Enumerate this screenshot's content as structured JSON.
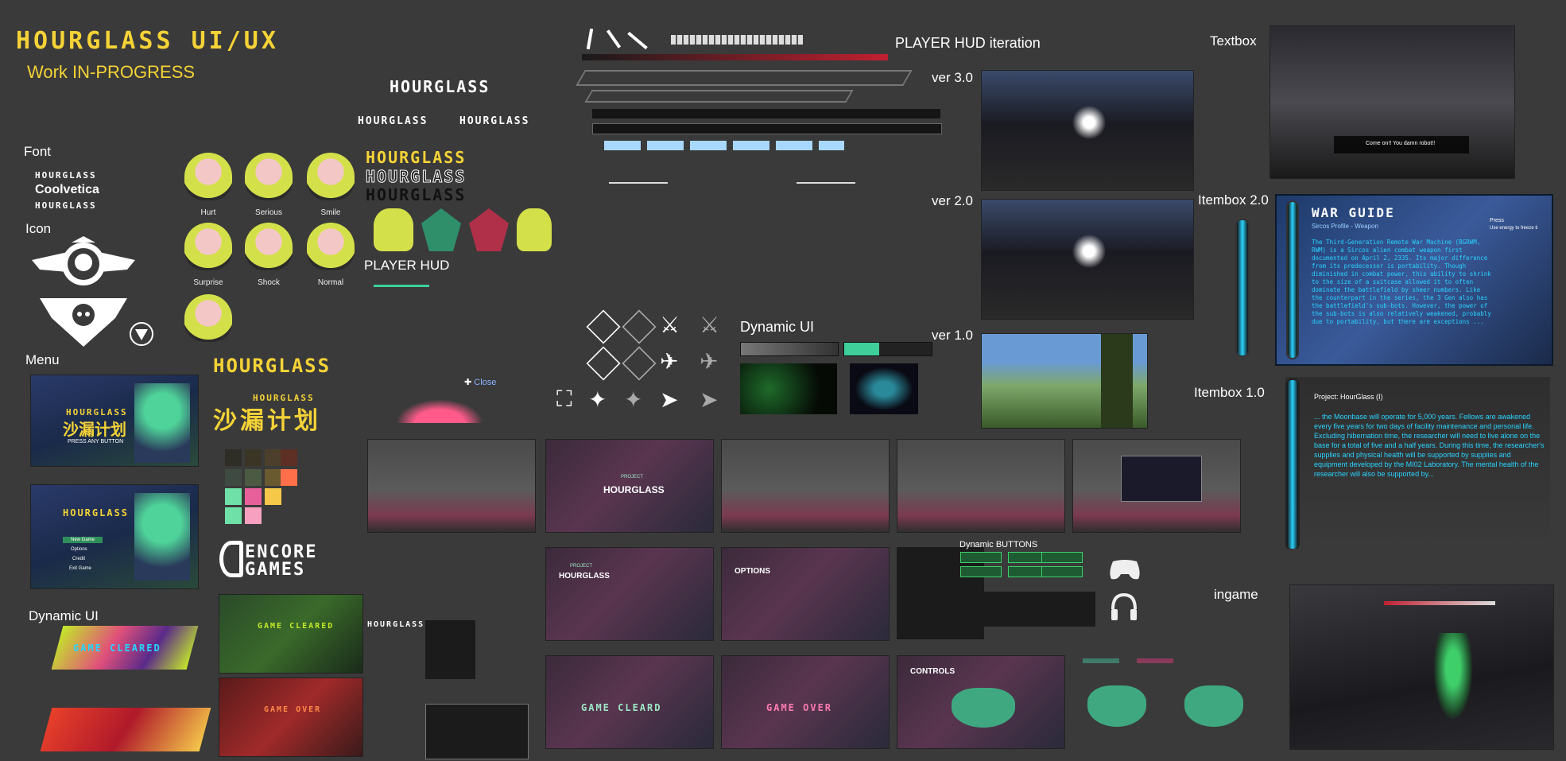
{
  "title": {
    "main": "HOURGLASS UI/UX",
    "subtitle": "Work IN-PROGRESS"
  },
  "sections": {
    "font": "Font",
    "icon": "Icon",
    "menu": "Menu",
    "dynamic_ui_left": "Dynamic UI",
    "player_hud": "PLAYER HUD",
    "dynamic_ui_mid": "Dynamic UI",
    "player_hud_iteration": "PLAYER HUD iteration",
    "textbox": "Textbox",
    "itembox_2": "Itembox 2.0",
    "itembox_1": "Itembox 1.0",
    "ingame": "ingame",
    "dynamic_buttons": "Dynamic BUTTONS"
  },
  "font_samples": [
    "HOURGLASS",
    "Coolvetica",
    "HOURGLASS"
  ],
  "logo_text": "HOURGLASS",
  "logo_cn": "沙漏计划",
  "expressions": [
    "Hurt",
    "Serious",
    "Smile",
    "Surprise",
    "Shock",
    "Normal"
  ],
  "hud_versions": [
    "ver 3.0",
    "ver 2.0",
    "ver 1.0"
  ],
  "menu_screens": {
    "press_any": "PRESS ANY BUTTON",
    "menu_items": [
      "New Game",
      "Options",
      "Credit",
      "Exit Game"
    ]
  },
  "close_label": "Close",
  "encore_logo": [
    "ENCORE",
    "GAMES"
  ],
  "project_label": "PROJECT",
  "game_cleared": "GAME CLEARED",
  "game_over": "GAME OVER",
  "game_cleard": "GAME CLEARD",
  "options_title": "OPTIONS",
  "controls_title": "CONTROLS",
  "textbox_line": "Come on!! You damn robot!!",
  "itembox2": {
    "title": "WAR GUIDE",
    "subtitle": "Sircos Profile - Weapon",
    "hint_press": "Press",
    "hint_text": "Use energy to freeze ti",
    "body": "The Third-Generation Remote War Machine (BGRWM, RWM) is a Sircos alien combat weapon first documented on April 2, 2335. Its major difference from its predecessor is portability. Though diminished in combat power, this ability to shrink to the size of a suitcase allowed it to often dominate the battlefield by sheer numbers. Like the counterpart in the series, the 3 Gen also has the battlefield's sub-bots. However, the power of the sub-bots is also relatively weakened, probably due to portability, but there are exceptions ..."
  },
  "itembox1": {
    "title": "Project: HourGlass (I)",
    "body": "... the Moonbase will operate for 5,000 years. Fellows are awakened every five years for two days of facility maintenance and personal life. Excluding hibernation time, the researcher will need to live alone on the base for a total of five and a half years. During this time, the researcher's supplies and physical health will be supported by supplies and equipment developed by the MI02 Laboratory. The mental health of the researcher will also be supported by..."
  },
  "colors": {
    "bg": "#3a3a3a",
    "yellow": "#f5d337",
    "teal": "#3fcf9a",
    "pink": "#e0507a",
    "cyan": "#2ad3ff",
    "palette": [
      "#2e2e26",
      "#3b3526",
      "#4c3f2b",
      "#5e2f25",
      "#3e4a42",
      "#4c5a44",
      "#6a5a30",
      "#ff6f4a",
      "#6fe0a8",
      "#e8609a",
      "#f5c84a",
      "#6fe0a8",
      "#f7a0c0"
    ]
  },
  "icons": {
    "emblem1": "winged-skull-emblem-icon",
    "emblem2": "skull-shield-icon",
    "emblem3": "triangle-badge-icon",
    "gamepad": "gamepad-icon",
    "headphones": "headphones-icon"
  }
}
